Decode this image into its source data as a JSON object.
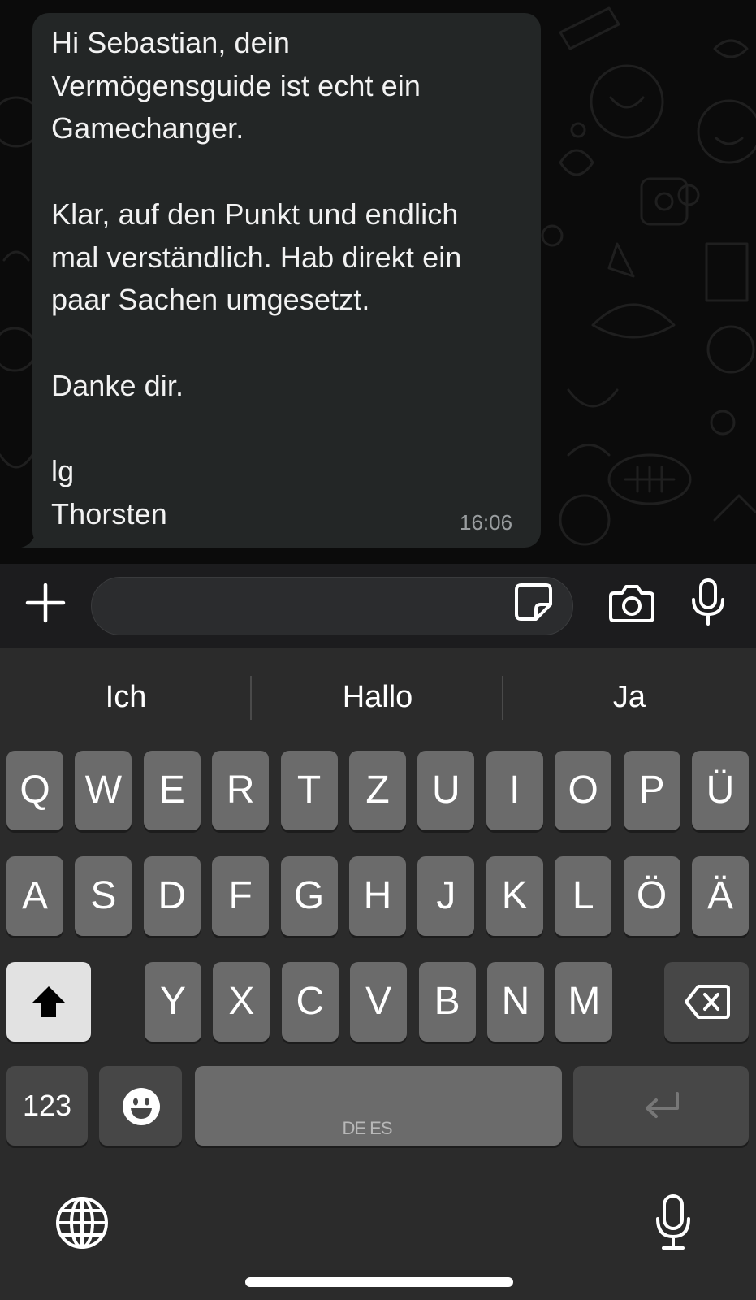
{
  "chat": {
    "message": {
      "text": "Hi Sebastian, dein\nVermögensguide ist echt ein\nGamechanger.\n\nKlar, auf den Punkt und endlich\nmal verständlich. Hab direkt ein\npaar Sachen umgesetzt.\n\nDanke dir.\n\nlg\nThorsten",
      "time": "16:06"
    }
  },
  "input_bar": {
    "icons": [
      "plus-icon",
      "sticker-icon",
      "camera-icon",
      "microphone-icon"
    ]
  },
  "keyboard": {
    "suggestions": [
      "Ich",
      "Hallo",
      "Ja"
    ],
    "row1": [
      "Q",
      "W",
      "E",
      "R",
      "T",
      "Z",
      "U",
      "I",
      "O",
      "P",
      "Ü"
    ],
    "row2": [
      "A",
      "S",
      "D",
      "F",
      "G",
      "H",
      "J",
      "K",
      "L",
      "Ö",
      "Ä"
    ],
    "row3": [
      "Y",
      "X",
      "C",
      "V",
      "B",
      "N",
      "M"
    ],
    "numbers_label": "123",
    "space_languages": "DE ES",
    "icons": [
      "shift-icon",
      "backspace-icon",
      "emoji-icon",
      "return-icon",
      "globe-icon",
      "microphone-icon"
    ]
  },
  "colors": {
    "bubble": "#232626",
    "keyboard_bg": "#2b2b2b",
    "key": "#6b6b6b",
    "key_dark": "#474747"
  }
}
